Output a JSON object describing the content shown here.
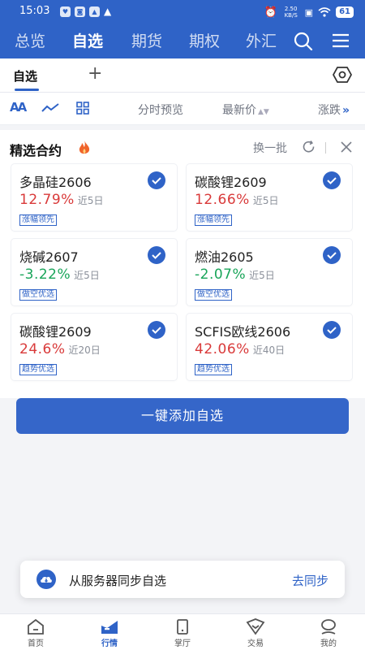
{
  "status": {
    "time": "15:03",
    "battery": "61",
    "speed": "2.50 KB/S"
  },
  "topnav": {
    "tabs": [
      "总览",
      "自选",
      "期货",
      "期权",
      "外汇"
    ],
    "active": 1
  },
  "subheader": {
    "label": "自选"
  },
  "toolbar": {
    "aa_label": "AA",
    "col_preview": "分时预览",
    "col_price": "最新价",
    "col_change": "涨跌"
  },
  "panel": {
    "title": "精选合约",
    "swap_label": "换一批",
    "cards": [
      {
        "name": "多晶硅2606",
        "pct": "12.79%",
        "period": "近5日",
        "tag": "涨幅领先",
        "dir": "up"
      },
      {
        "name": "碳酸锂2609",
        "pct": "12.66%",
        "period": "近5日",
        "tag": "涨幅领先",
        "dir": "up"
      },
      {
        "name": "烧碱2607",
        "pct": "-3.22%",
        "period": "近5日",
        "tag": "做空优选",
        "dir": "down"
      },
      {
        "name": "燃油2605",
        "pct": "-2.07%",
        "period": "近5日",
        "tag": "做空优选",
        "dir": "down"
      },
      {
        "name": "碳酸锂2609",
        "pct": "24.6%",
        "period": "近20日",
        "tag": "趋势优选",
        "dir": "up"
      },
      {
        "name": "SCFIS欧线2606",
        "pct": "42.06%",
        "period": "近40日",
        "tag": "趋势优选",
        "dir": "up"
      }
    ]
  },
  "add_button": "一键添加自选",
  "sync": {
    "text": "从服务器同步自选",
    "action": "去同步"
  },
  "bottomnav": {
    "items": [
      "首页",
      "行情",
      "掌厅",
      "交易",
      "我的"
    ],
    "active": 1
  },
  "colors": {
    "primary": "#2f63c7",
    "up": "#d93a3a",
    "down": "#1aa55a"
  }
}
